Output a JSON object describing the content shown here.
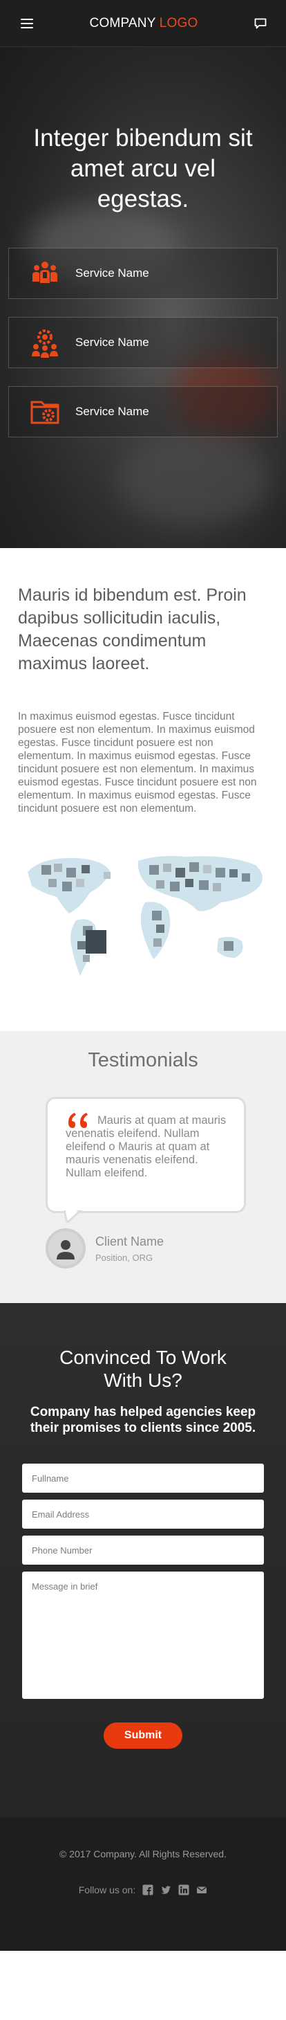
{
  "header": {
    "logo_main": "COMPANY",
    "logo_accent": "LOGO"
  },
  "hero": {
    "title": "Integer bibendum sit amet arcu vel egestas.",
    "services": [
      {
        "label": "Service Name",
        "icon": "team-icon"
      },
      {
        "label": "Service Name",
        "icon": "gear-people-icon"
      },
      {
        "label": "Service Name",
        "icon": "folder-gear-icon"
      }
    ]
  },
  "intro": {
    "heading": "Mauris id bibendum est. Proin dapibus sollicitudin iaculis, Maecenas condimentum maximus laoreet.",
    "body": "In maximus euismod egestas. Fusce tincidunt posuere est non elementum. In maximus euismod egestas. Fusce tincidunt posuere est non elementum. In maximus euismod egestas. Fusce tincidunt posuere est non elementum. In maximus euismod egestas. Fusce tincidunt posuere est non elementum. In maximus euismod egestas. Fusce tincidunt posuere est non elementum."
  },
  "testimonials": {
    "title": "Testimonials",
    "quote": "Mauris at quam at mauris venenatis eleifend. Nullam eleifend o Mauris at quam at mauris venenatis eleifend. Nullam eleifend.",
    "client_name": "Client Name",
    "client_position": "Position, ORG"
  },
  "contact": {
    "title": "Convinced To Work With Us?",
    "lead": "Company has helped agencies keep their promises to clients since 2005.",
    "fields": {
      "fullname": "Fullname",
      "email": "Email Address",
      "phone": "Phone Number",
      "message": "Message in brief"
    },
    "submit_label": "Submit"
  },
  "footer": {
    "copyright": "© 2017 Company. All Rights Reserved.",
    "follow_label": "Follow us on:",
    "social_icons": [
      "facebook-icon",
      "twitter-icon",
      "linkedin-icon",
      "email-icon"
    ]
  },
  "colors": {
    "accent": "#e84a1b",
    "submit": "#e83a0e",
    "header_bg": "#1f1f1f",
    "footer_bg": "#1e1e1e",
    "testimonial_bg": "#f0f0f0"
  }
}
